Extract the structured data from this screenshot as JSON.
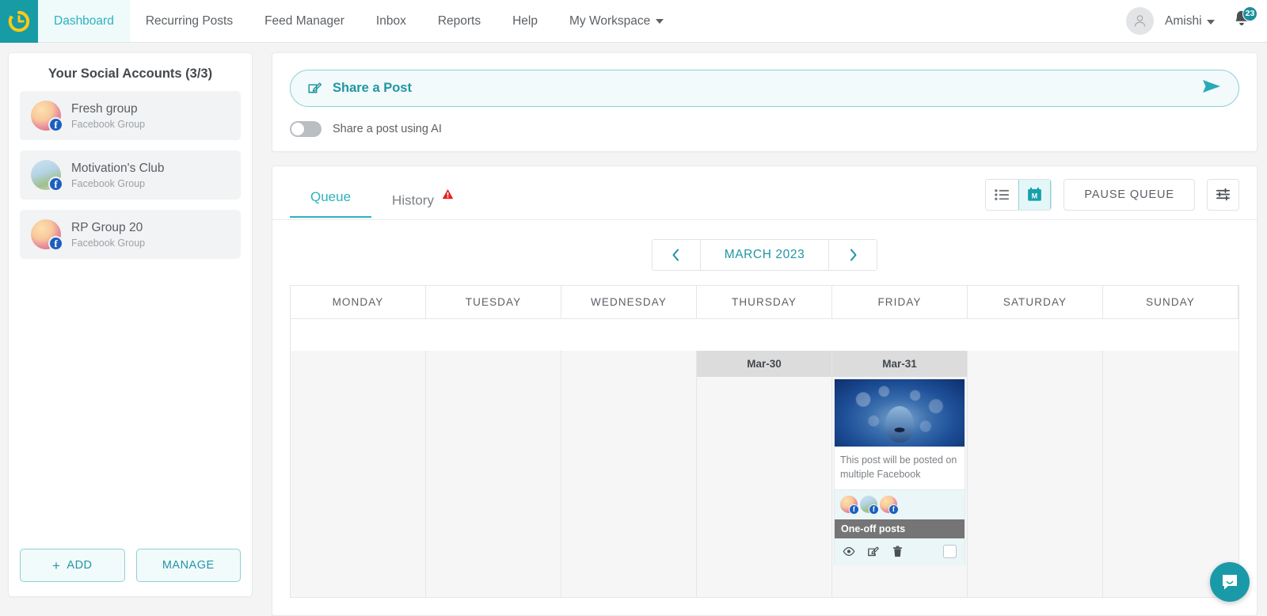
{
  "topnav": {
    "logo_icon": "clock-history-icon",
    "items": [
      {
        "label": "Dashboard",
        "active": true
      },
      {
        "label": "Recurring Posts",
        "active": false
      },
      {
        "label": "Feed Manager",
        "active": false
      },
      {
        "label": "Inbox",
        "active": false
      },
      {
        "label": "Reports",
        "active": false
      },
      {
        "label": "Help",
        "active": false
      },
      {
        "label": "My Workspace",
        "active": false,
        "caret": true
      }
    ],
    "user_name": "Amishi",
    "notification_count": "23",
    "accent": "#2bb3bf",
    "logo_bg": "#179ba5"
  },
  "sidebar": {
    "title": "Your Social Accounts (3/3)",
    "accounts": [
      {
        "name": "Fresh group",
        "type": "Facebook Group",
        "network": "facebook"
      },
      {
        "name": "Motivation's Club",
        "type": "Facebook Group",
        "network": "facebook"
      },
      {
        "name": "RP Group 20",
        "type": "Facebook Group",
        "network": "facebook"
      }
    ],
    "add_label": "ADD",
    "manage_label": "MANAGE"
  },
  "share": {
    "pill_label": "Share a Post",
    "pill_icon": "compose-icon",
    "send_icon": "send-icon",
    "ai_toggle_label": "Share a post using AI",
    "ai_toggle_on": false
  },
  "queue": {
    "tabs": [
      {
        "label": "Queue",
        "active": true,
        "warning": false
      },
      {
        "label": "History",
        "active": false,
        "warning": true
      }
    ],
    "view_list_icon": "list-view-icon",
    "view_calendar_icon": "month-calendar-icon",
    "calendar_icon_letter": "M",
    "pause_label": "PAUSE QUEUE",
    "filter_icon": "filter-sliders-icon"
  },
  "calendar": {
    "prev_icon": "chevron-left-icon",
    "next_icon": "chevron-right-icon",
    "month_label": "MARCH 2023",
    "day_headers": [
      "MONDAY",
      "TUESDAY",
      "WEDNESDAY",
      "THURSDAY",
      "FRIDAY",
      "SATURDAY",
      "SUNDAY"
    ],
    "days": [
      {
        "date": "",
        "has_date": false,
        "post": null
      },
      {
        "date": "",
        "has_date": false,
        "post": null
      },
      {
        "date": "",
        "has_date": false,
        "post": null
      },
      {
        "date": "Mar-30",
        "has_date": true,
        "post": null
      },
      {
        "date": "Mar-31",
        "has_date": true,
        "post": {
          "text": "This post will be posted on multiple Facebook",
          "type_label": "One-off posts",
          "accounts": 3,
          "actions": [
            "preview-icon",
            "edit-icon",
            "delete-icon"
          ],
          "checked": false
        }
      },
      {
        "date": "",
        "has_date": false,
        "post": null
      },
      {
        "date": "",
        "has_date": false,
        "post": null
      }
    ]
  },
  "chat": {
    "icon": "chat-bubble-icon",
    "color": "#1a9aa8"
  }
}
